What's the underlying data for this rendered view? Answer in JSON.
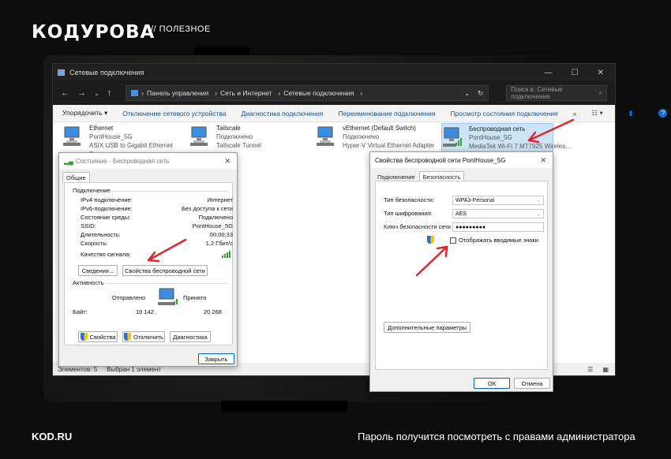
{
  "brand": {
    "logo": "КОДУРОВА",
    "tag": "// ПОЛЕЗНОЕ",
    "site": "KOD.RU",
    "caption": "Пароль получится посмотреть с правами администратора"
  },
  "explorer": {
    "title": "Сетевые подключения",
    "breadcrumb": [
      "Панель управления",
      "Сеть и Интернет",
      "Сетевые подключения"
    ],
    "search_placeholder": "Поиск в: Сетевые подключения",
    "commands": [
      "Упорядочить ▾",
      "Отключение сетевого устройства",
      "Диагностика подключения",
      "Переименование подключения",
      "Просмотр состояния подключения"
    ],
    "adapters": [
      {
        "name": "Ethernet",
        "status": "PontHouse_5G",
        "device": "ASIX USB to Gigabit Ethernet Fam..."
      },
      {
        "name": "Tailscale",
        "status": "Подключено",
        "device": "Tailscale Tunnel"
      },
      {
        "name": "vEthernet (Default Switch)",
        "status": "Подключено",
        "device": "Hyper-V Virtual Ethernet Adapter"
      },
      {
        "name": "Беспроводная сеть",
        "status": "PontHouse_5G",
        "device": "MediaTek Wi-Fi 7 MT7925 Wireles..."
      }
    ],
    "status_items": "Элементов: 5",
    "status_selected": "Выбран 1 элемент"
  },
  "status_dialog": {
    "title": "Состояние - Беспроводная сеть",
    "tab": "Общие",
    "connection_label": "Подключение",
    "rows": [
      {
        "k": "IPv4-подключение:",
        "v": "Интернет"
      },
      {
        "k": "IPv6-подключение:",
        "v": "Без доступа к сети"
      },
      {
        "k": "Состояние среды:",
        "v": "Подключено"
      },
      {
        "k": "SSID:",
        "v": "PontHouse_5G"
      },
      {
        "k": "Длительность:",
        "v": "00:00:33"
      },
      {
        "k": "Скорость:",
        "v": "1.2 Гбит/с"
      }
    ],
    "signal_label": "Качество сигнала:",
    "details_button": "Сведения...",
    "wireless_props_button": "Свойства беспроводной сети",
    "activity_label": "Активность",
    "sent_label": "Отправлено",
    "received_label": "Принято",
    "bytes_label": "Байт:",
    "bytes_sent": "10 142",
    "bytes_received": "20 268",
    "props_button": "Свойства",
    "disable_button": "Отключить",
    "diag_button": "Диагностика",
    "close_button": "Закрыть"
  },
  "wifi_dialog": {
    "title": "Свойства беспроводной сети PontHouse_5G",
    "tabs": [
      "Подключение",
      "Безопасность"
    ],
    "security_type_label": "Тип безопасности:",
    "security_type": "WPA3-Personal",
    "encryption_label": "Тип шифрования:",
    "encryption": "AES",
    "key_label": "Ключ безопасности сети",
    "key_value": "●●●●●●●●●",
    "show_chars_label": "Отображать вводимые знаки",
    "advanced_button": "Дополнительные параметры",
    "ok_button": "ОК",
    "cancel_button": "Отмена"
  },
  "colors": {
    "accent": "#0067c0",
    "arrow": "#e0262a",
    "signal": "#3aa335"
  }
}
